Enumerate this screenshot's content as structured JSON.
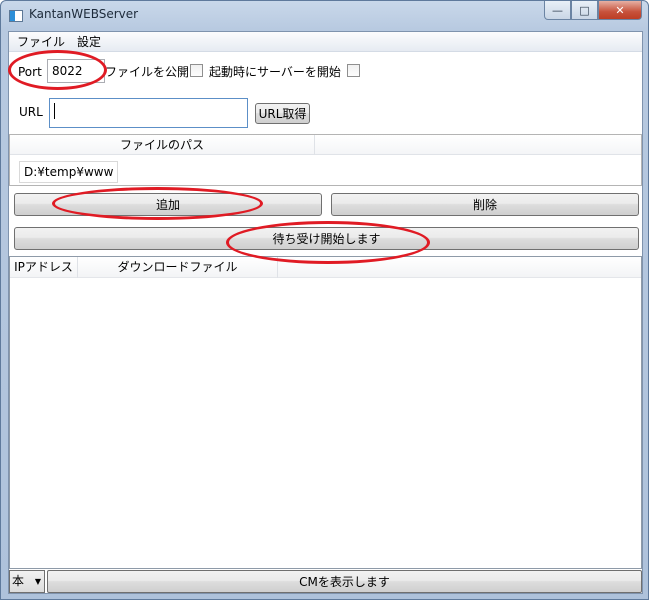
{
  "window": {
    "title": "KantanWEBServer",
    "minimize_icon": "minimize-icon",
    "maximize_icon": "maximize-icon",
    "close_icon": "close-icon"
  },
  "menu": {
    "items": [
      "ファイル",
      "設定"
    ]
  },
  "settings": {
    "port_label": "Port",
    "port_value": "8022",
    "publish_file_label": "ファイルを公開",
    "publish_file_checked": false,
    "start_on_launch_label": "起動時にサーバーを開始",
    "start_on_launch_checked": false
  },
  "url": {
    "label": "URL",
    "value": "",
    "fetch_button": "URL取得"
  },
  "path_table": {
    "headers": [
      "ファイルのパス",
      ""
    ],
    "rows": [
      "D:¥temp¥www"
    ]
  },
  "actions": {
    "add": "追加",
    "delete": "削除",
    "start_listening": "待ち受け開始します"
  },
  "log_table": {
    "headers": [
      "IPアドレス",
      "ダウンロードファイル",
      ""
    ],
    "rows": []
  },
  "footer": {
    "mode_selected": "本",
    "cm_button": "CMを表示します"
  },
  "annotation_color": "#e01b24"
}
